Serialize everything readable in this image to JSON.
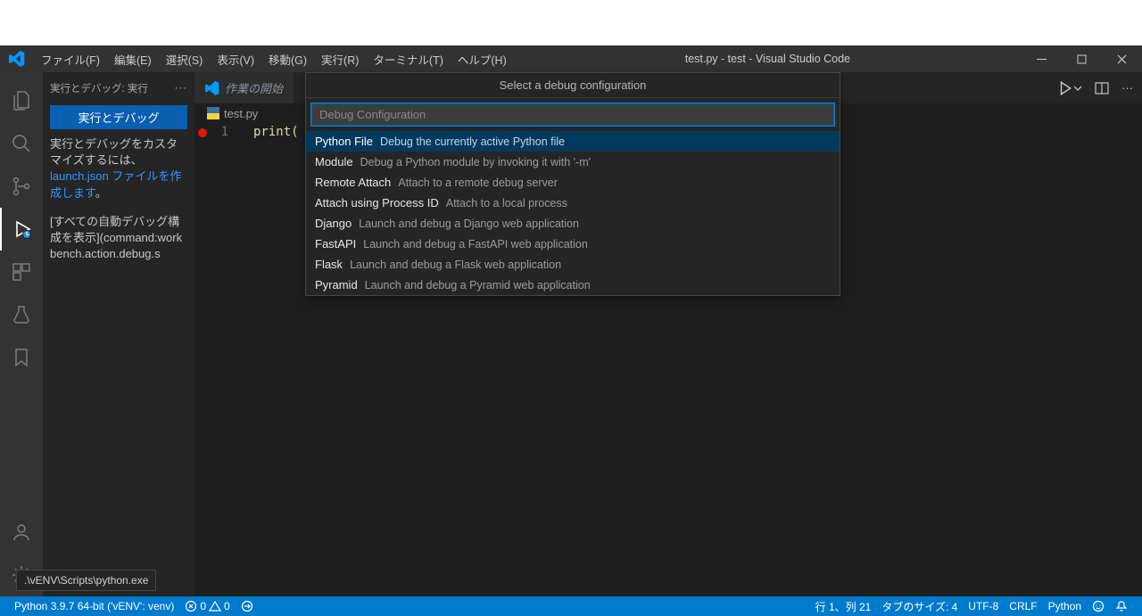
{
  "window": {
    "title": "test.py - test - Visual Studio Code"
  },
  "menu": {
    "file": "ファイル(F)",
    "edit": "編集(E)",
    "select": "選択(S)",
    "view": "表示(V)",
    "go": "移動(G)",
    "run": "実行(R)",
    "terminal": "ターミナル(T)",
    "help": "ヘルプ(H)"
  },
  "sidebar": {
    "header": "実行とデバッグ: 実行",
    "run_button": "実行とデバッグ",
    "para1a": "実行とデバッグをカスタマイズするには、",
    "para1b": "launch.json ファイルを作成します",
    "para1c": "。",
    "para2": "[すべての自動デバッグ構成を表示](command:workbench.action.debug.s"
  },
  "tabs": {
    "welcome": "作業の開始",
    "testpy": "test.py"
  },
  "editor": {
    "line_no": "1",
    "code": "print("
  },
  "quickpick": {
    "title": "Select a debug configuration",
    "placeholder": "Debug Configuration",
    "items": [
      {
        "label": "Python File",
        "desc": "Debug the currently active Python file"
      },
      {
        "label": "Module",
        "desc": "Debug a Python module by invoking it with '-m'"
      },
      {
        "label": "Remote Attach",
        "desc": "Attach to a remote debug server"
      },
      {
        "label": "Attach using Process ID",
        "desc": "Attach to a local process"
      },
      {
        "label": "Django",
        "desc": "Launch and debug a Django web application"
      },
      {
        "label": "FastAPI",
        "desc": "Launch and debug a FastAPI web application"
      },
      {
        "label": "Flask",
        "desc": "Launch and debug a Flask web application"
      },
      {
        "label": "Pyramid",
        "desc": "Launch and debug a Pyramid web application"
      }
    ]
  },
  "status": {
    "interpreter": "Python 3.9.7 64-bit ('vENV': venv)",
    "errors": "0",
    "warnings": "0",
    "cursor": "行 1、列 21",
    "spaces": "タブのサイズ: 4",
    "encoding": "UTF-8",
    "eol": "CRLF",
    "lang": "Python"
  },
  "tooltip": ".\\vENV\\Scripts\\python.exe"
}
